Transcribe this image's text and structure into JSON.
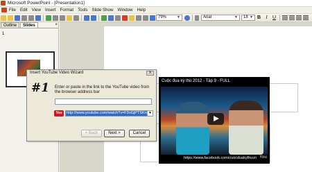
{
  "window": {
    "title": "Microsoft PowerPoint - [Presentation1]"
  },
  "menu": [
    "File",
    "Edit",
    "View",
    "Insert",
    "Format",
    "Tools",
    "Slide Show",
    "Window",
    "Help"
  ],
  "toolbar": {
    "zoom": "79%",
    "font": "Arial",
    "font_size": "18",
    "bold": "B",
    "italic": "I",
    "underline": "U"
  },
  "outline_pane": {
    "tabs": [
      "Outline",
      "Slides"
    ],
    "active_tab": "Slides",
    "slide_number": "1"
  },
  "dialog": {
    "title": "Insert YouTube Video Wizard",
    "close": "X",
    "step": "#1",
    "instruction": "Enter or paste in the link to the YouTube video from the browser address bar",
    "url_value": "http://www.youtube.com/watch?v=F3oGjPTSKro",
    "buttons": {
      "back": "< Back",
      "next": "Next >",
      "cancel": "Cancel"
    }
  },
  "video": {
    "title": "Cuộc đua kỳ thú 2012 - Tập 9 - FULL",
    "footer": "https://www.facebook.com/cuocduakythuvn",
    "watermark": "You"
  }
}
